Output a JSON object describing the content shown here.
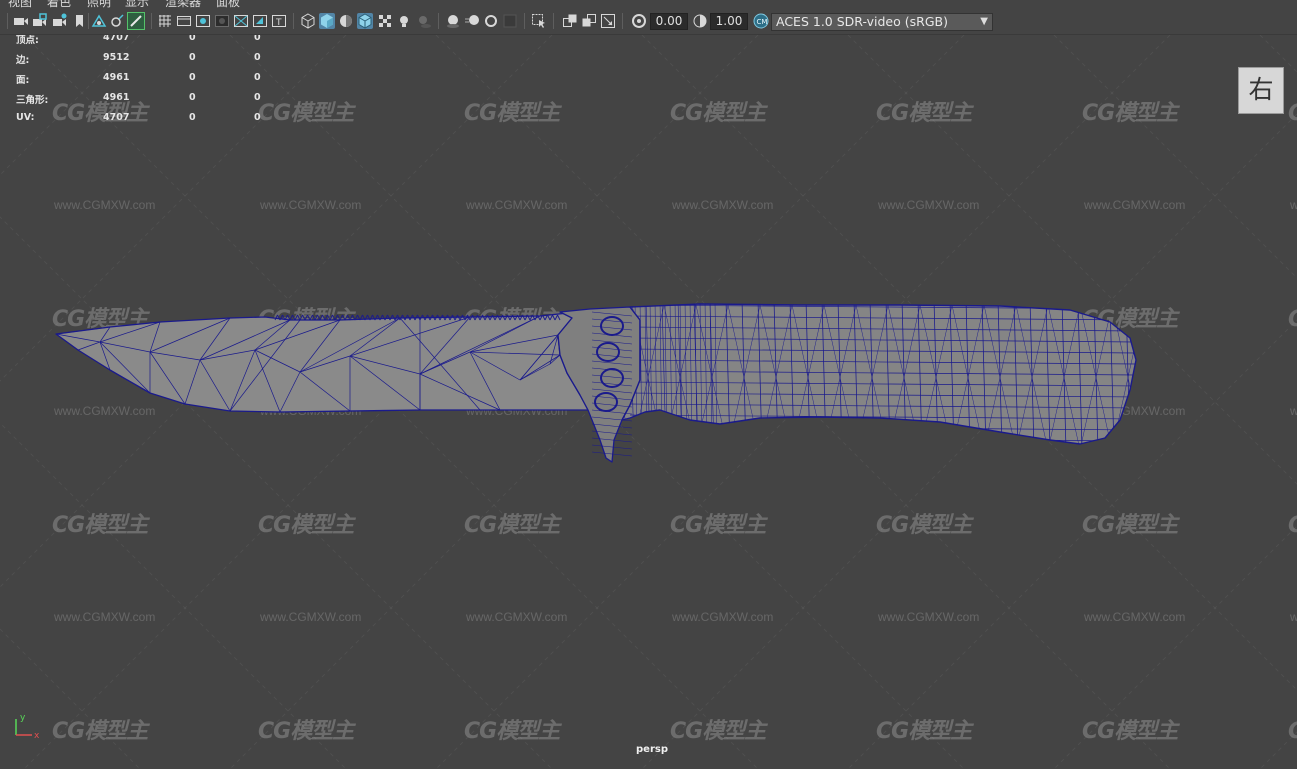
{
  "menu": {
    "items": [
      "视图",
      "着色",
      "照明",
      "显示",
      "渲染器",
      "面板"
    ]
  },
  "toolbar": {
    "icons": [
      "camera-icon",
      "camera-lock-icon",
      "camera-attributes-icon",
      "bookmark-icon",
      "image-plane-icon",
      "2d-pan-zoom-icon",
      "grease-pencil-icon",
      "grid-icon",
      "film-gate-icon",
      "resolution-gate-icon",
      "gate-mask-icon",
      "field-chart-icon",
      "safe-action-icon",
      "safe-title-icon",
      "wireframe-icon",
      "smooth-shade-icon",
      "default-material-icon",
      "wireframe-on-shaded-icon",
      "xray-icon",
      "use-all-lights-icon",
      "shadows-icon",
      "screen-space-ao-icon",
      "motion-blur-icon",
      "antialias-icon",
      "depth-of-field-icon",
      "isolate-select-icon",
      "xray-joints-icon",
      "xray-components-icon",
      "hud-icon",
      "exposure-icon",
      "gamma-icon",
      "color-management-icon"
    ],
    "exposure_value": "0.00",
    "gamma_value": "1.00",
    "color_space": "ACES 1.0 SDR-video (sRGB)"
  },
  "hud": {
    "rows": [
      {
        "label": "顶点:",
        "a": "4707",
        "b": "0",
        "c": "0"
      },
      {
        "label": "边:",
        "a": "9512",
        "b": "0",
        "c": "0"
      },
      {
        "label": "面:",
        "a": "4961",
        "b": "0",
        "c": "0"
      },
      {
        "label": "三角形:",
        "a": "4961",
        "b": "0",
        "c": "0"
      },
      {
        "label": "UV:",
        "a": "4707",
        "b": "0",
        "c": "0"
      }
    ]
  },
  "viewcube": {
    "label": "右"
  },
  "camera_label": "persp",
  "axis": {
    "x": "x",
    "y": "y"
  },
  "watermark": {
    "logo": "CG模型主",
    "url": "www.CGMXW.com"
  },
  "colors": {
    "viewport_bg": "#444444",
    "mesh_fill": "#8a8a8a",
    "wireframe": "#1a1a8c",
    "toolbar_active": "#5285a6"
  }
}
